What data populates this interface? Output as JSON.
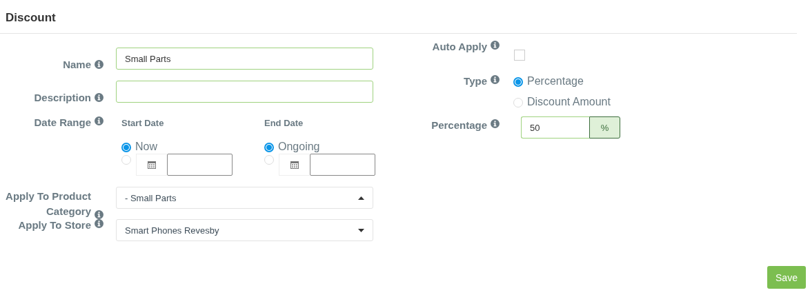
{
  "title": "Discount",
  "name": {
    "label": "Name",
    "value": "Small Parts"
  },
  "description": {
    "label": "Description"
  },
  "date_range": {
    "label": "Date Range",
    "start": {
      "heading": "Start Date",
      "options": [
        {
          "kind": "text",
          "label": "Now",
          "selected": true
        },
        {
          "kind": "date",
          "selected": false
        }
      ]
    },
    "end": {
      "heading": "End Date",
      "options": [
        {
          "kind": "text",
          "label": "Ongoing",
          "selected": true
        },
        {
          "kind": "date",
          "selected": false
        }
      ]
    }
  },
  "product_category": {
    "label": "Apply To Product Category",
    "value": "- Small Parts",
    "expanded": true
  },
  "store": {
    "label": "Apply To Store",
    "value": "Smart Phones Revesby",
    "expanded": false
  },
  "auto_apply": {
    "label": "Auto Apply",
    "checked": false
  },
  "type": {
    "label": "Type",
    "options": [
      {
        "label": "Percentage",
        "selected": true
      },
      {
        "label": "Discount Amount",
        "selected": false
      }
    ]
  },
  "percentage": {
    "label": "Percentage",
    "value": "50",
    "unit": "%"
  },
  "save": "Save"
}
